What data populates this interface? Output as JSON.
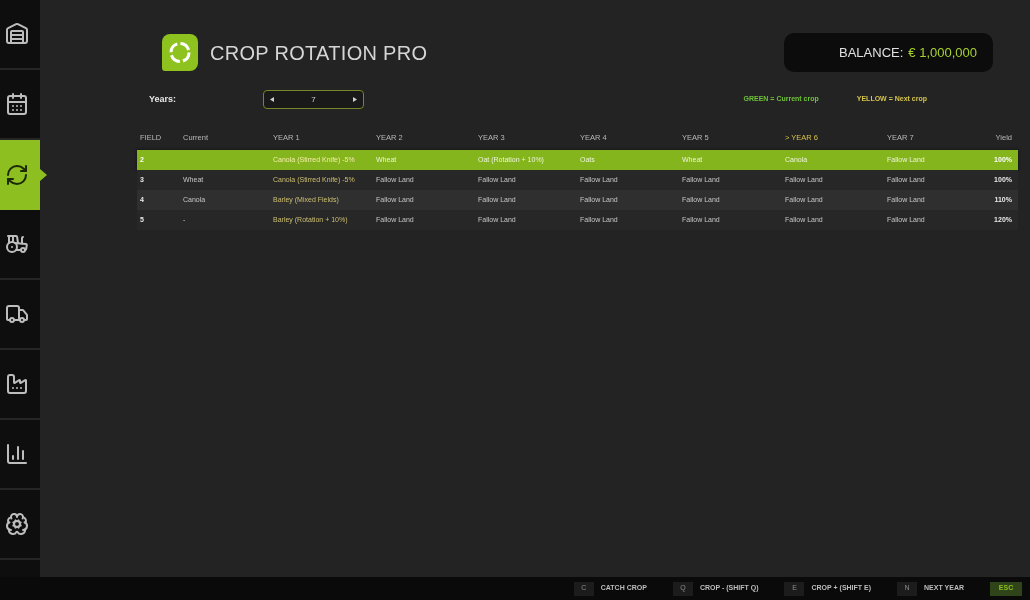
{
  "sidebar": {
    "items": [
      {
        "selected": false
      },
      {
        "selected": false
      },
      {
        "selected": true
      },
      {
        "selected": false
      },
      {
        "selected": false
      },
      {
        "selected": false
      },
      {
        "selected": false
      },
      {
        "selected": false
      }
    ]
  },
  "header": {
    "title": "CROP ROTATION PRO",
    "balance_label": "BALANCE:",
    "balance_value": "€ 1,000,000"
  },
  "years": {
    "label": "Years:",
    "value": "7"
  },
  "legend": [
    {
      "text": "GREEN = Current crop",
      "color": "#6fc23a"
    },
    {
      "text": "YELLOW = Next crop",
      "color": "#d4c44a"
    }
  ],
  "table": {
    "columns": [
      {
        "label": "FIELD",
        "kind": "field",
        "highlighted": false,
        "next_crop": false
      },
      {
        "label": "Current",
        "kind": "current",
        "highlighted": false,
        "next_crop": false
      },
      {
        "label": "YEAR 1",
        "kind": "year",
        "highlighted": false,
        "next_crop": true
      },
      {
        "label": "YEAR 2",
        "kind": "year",
        "highlighted": false,
        "next_crop": false
      },
      {
        "label": "YEAR 3",
        "kind": "year",
        "highlighted": false,
        "next_crop": false
      },
      {
        "label": "YEAR 4",
        "kind": "year",
        "highlighted": false,
        "next_crop": false
      },
      {
        "label": "YEAR 5",
        "kind": "year",
        "highlighted": false,
        "next_crop": false
      },
      {
        "label": "> YEAR 6",
        "kind": "year",
        "highlighted": true,
        "next_crop": false
      },
      {
        "label": "YEAR 7",
        "kind": "year",
        "highlighted": false,
        "next_crop": false
      },
      {
        "label": "Yield",
        "kind": "yield",
        "highlighted": false,
        "next_crop": false
      }
    ],
    "rows": [
      {
        "field": "2",
        "years": [
          "Canola (Stirred Knife) -5%",
          "Wheat",
          "Oat (Rotation + 10%)",
          "Oats",
          "Wheat",
          "Canola",
          "Fallow Land"
        ],
        "yield": "100%",
        "selected": true
      },
      {
        "field": "3",
        "current": "Wheat",
        "years": [
          "Canola (Stirred Knife) -5%",
          "Fallow Land",
          "Fallow Land",
          "Fallow Land",
          "Fallow Land",
          "Fallow Land",
          "Fallow Land"
        ],
        "yield": "100%",
        "selected": false
      },
      {
        "field": "4",
        "current": "Canola",
        "years": [
          "Barley (Mixed Fields)",
          "Fallow Land",
          "Fallow Land",
          "Fallow Land",
          "Fallow Land",
          "Fallow Land",
          "Fallow Land"
        ],
        "yield": "110%",
        "selected": false
      },
      {
        "field": "5",
        "current": "-",
        "years": [
          "Barley (Rotation + 10%)",
          "Fallow Land",
          "Fallow Land",
          "Fallow Land",
          "Fallow Land",
          "Fallow Land",
          "Fallow Land"
        ],
        "yield": "120%",
        "selected": false
      }
    ]
  },
  "key_hints": [
    {
      "key": "C",
      "label": "CATCH CROP",
      "kind": "normal"
    },
    {
      "key": "Q",
      "label": "CROP - (SHIFT Q)",
      "kind": "normal"
    },
    {
      "key": "E",
      "label": "CROP + (SHIFT E)",
      "kind": "normal"
    },
    {
      "key": "N",
      "label": "NEXT YEAR",
      "kind": "normal"
    },
    {
      "key": "ESC",
      "kind": "primary"
    }
  ]
}
